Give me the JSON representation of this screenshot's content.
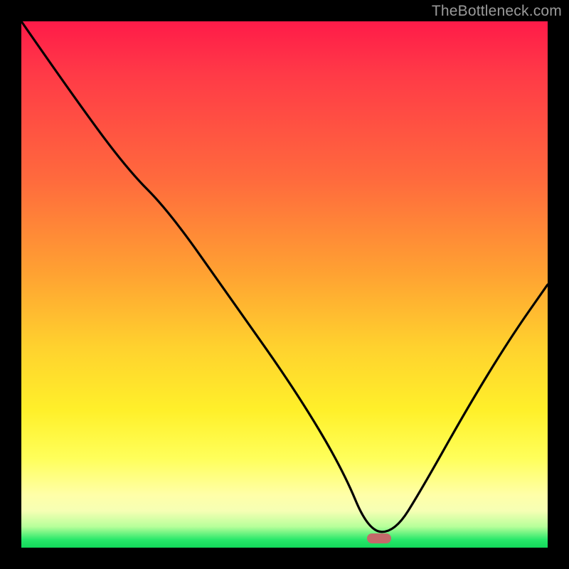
{
  "watermark": "TheBottleneck.com",
  "colors": {
    "frame": "#000000",
    "curve": "#000000",
    "marker": "#c46a6a",
    "gradient_top": "#ff1b49",
    "gradient_bottom": "#12d85a"
  },
  "marker": {
    "x_frac": 0.68,
    "y_frac": 0.982
  },
  "chart_data": {
    "type": "line",
    "title": "",
    "xlabel": "",
    "ylabel": "",
    "xlim": [
      0,
      1
    ],
    "ylim": [
      0,
      1
    ],
    "note": "Axes are unlabeled in the source image; x and y are expressed as 0–1 fractions of the plot area (y=1 at top). Curve is a V-shape with minimum near x≈0.68 and a small flat segment at the bottom around the marker.",
    "series": [
      {
        "name": "bottleneck-curve",
        "x": [
          0.0,
          0.09,
          0.2,
          0.28,
          0.4,
          0.52,
          0.61,
          0.66,
          0.71,
          0.76,
          0.85,
          0.93,
          1.0
        ],
        "y": [
          1.0,
          0.87,
          0.72,
          0.64,
          0.47,
          0.3,
          0.15,
          0.03,
          0.03,
          0.11,
          0.27,
          0.4,
          0.5
        ]
      }
    ],
    "marker": {
      "x": 0.68,
      "y": 0.02,
      "shape": "rounded-rect"
    }
  }
}
